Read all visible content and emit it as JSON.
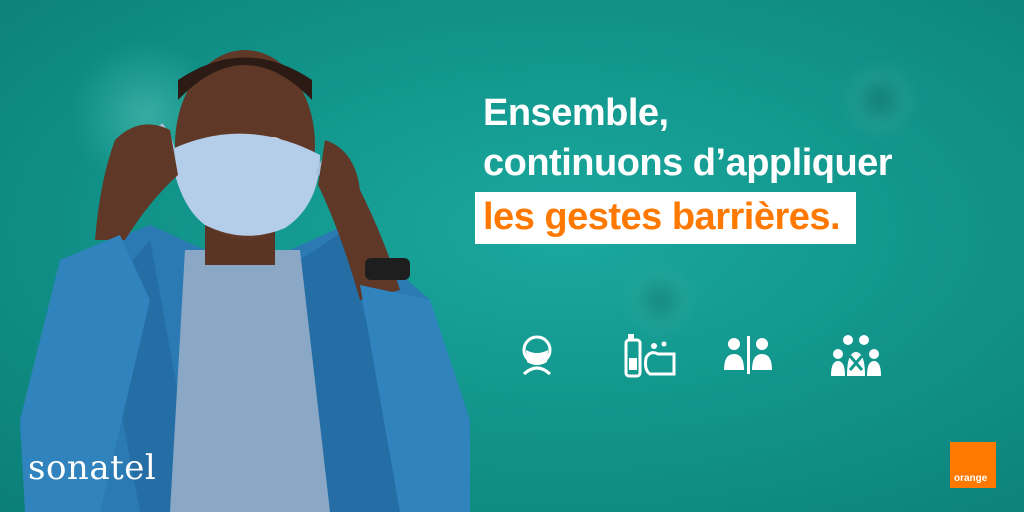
{
  "headline": {
    "line1": "Ensemble,",
    "line2": "continuons d’appliquer",
    "highlight": "les gestes barrières."
  },
  "icons": [
    "mask-icon",
    "hand-wash-icon",
    "distance-icon",
    "no-gathering-icon"
  ],
  "brand": {
    "sonatel": "sonatel",
    "orange": "orange"
  },
  "colors": {
    "background": "#12968c",
    "accent": "#ff7900",
    "text": "#ffffff"
  }
}
